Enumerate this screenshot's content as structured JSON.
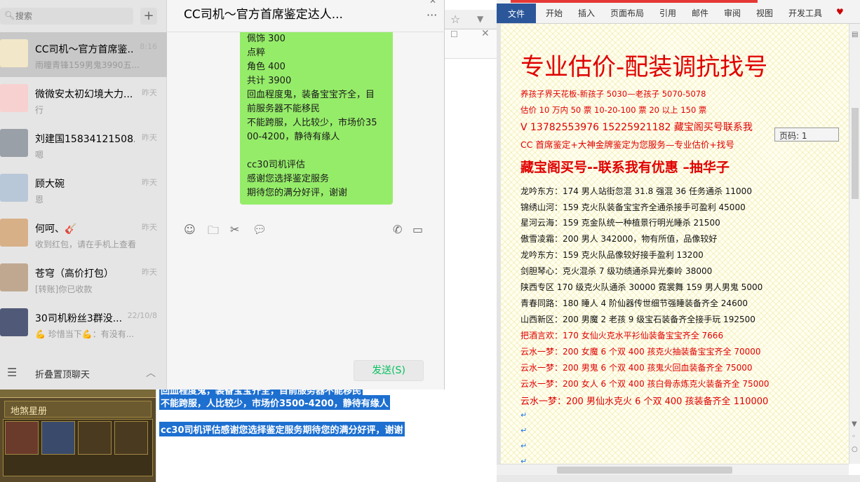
{
  "wechat": {
    "search_placeholder": "搜索",
    "add_label": "+",
    "conversations": [
      {
        "name": "CC司机～官方首席鉴...",
        "msg": "雨瞳青锋159男鬼3990五...",
        "time": "8:16"
      },
      {
        "name": "微微安太初幻境大力...",
        "msg": "行",
        "time": "昨天"
      },
      {
        "name": "刘建国1583412150​8...",
        "msg": "嗯",
        "time": "昨天"
      },
      {
        "name": "顾大碗",
        "msg": "恩",
        "time": "昨天"
      },
      {
        "name": "何呵、🎸",
        "msg": "收到红包，请在手机上查看",
        "time": "昨天"
      },
      {
        "name": "苍穹（高价打包）",
        "msg": "[转账]你已收款",
        "time": "昨天"
      },
      {
        "name": "30司机粉丝3群没...",
        "msg": "💪 珍惜当下💪：有没有...",
        "time": "22/10/8"
      }
    ],
    "fold_label": "折叠置顶聊天",
    "chat_title": "CC司机～官方首席鉴定达人...",
    "bubble_lines": [
      "佩饰                300",
      "点粹",
      "角色                    400",
      "共计 3900",
      "回血程度鬼，装备宝宝齐全，目",
      "前服务器不能移民",
      "不能跨服，人比较少，市场价35",
      "00-4200，静待有缘人",
      "",
      "cc30司机评估",
      "感谢您选择鉴定服务",
      "期待您的满分好评，谢谢"
    ],
    "send_label": "发送(S)"
  },
  "background": {
    "game_panel_title": "地煞星册",
    "selected_lines": [
      "回血程度鬼，装备宝宝齐全，目前服务器不能移民",
      "不能跨服，人比较少，市场价3500-4200，静待有缘人",
      "cc30司机评估感谢您选择鉴定服务期待您的满分好评，谢谢"
    ]
  },
  "word": {
    "tabs": [
      "文件",
      "开始",
      "插入",
      "页面布局",
      "引用",
      "邮件",
      "审阅",
      "视图",
      "开发工具"
    ],
    "page_tip": "页码: 1",
    "title": "专业估价-配装调抗找号",
    "lines": [
      "养孩子界天花板-新孩子 5030—老孩子 5070-5078",
      "估价 10 万内 50 票    10-20-100 票      20 以上 150 票",
      "V 13782553976    15225921182  藏宝阁买号联系我",
      "CC 首席鉴定+大神金牌鉴定为您服务—专业估价+找号",
      "藏宝阁买号--联系我有优惠 –抽华子",
      "龙吟东方：174 男人站街忽混 31.8 强混 36 任务通杀 11000",
      "锦绣山河：159 克火队装备宝宝齐全通杀接手可盈利 45000",
      "星河云海：159 克金队统一种植景行明光睡杀 21500",
      "傲雪凌霜：200 男人 342000，物有所值，品像较好",
      "龙吟东方：159 克火队品像较好接手盈利 13200",
      "剑胆琴心：克火混杀 7 级功绩通杀异光秦岭 38000",
      "陕西专区 170 级克火队通杀 30000      霓裳舞 159 男人男鬼 5000",
      "青春同路：180 睡人 4 阶仙器传世细节强睡装备齐全 24600",
      "山西新区：200 男魔 2 老孩 9 级宝石装备齐全接手玩 192500",
      "把酒言欢：170 女仙火克水平衫仙装备宝宝齐全 7666",
      "云水一梦：200 女魔 6 个双 400 孩克火抽装备宝宝齐全 70000",
      "云水一梦：200 男鬼 6 个双 400 孩鬼火回血装备齐全 75000",
      "云水一梦：200 女人 6 个双 400 孩白骨赤炼克火装备齐全 75000",
      "云水一梦：200 男仙水克火 6 个双 400 孩装备齐全 110000"
    ]
  },
  "colors": {
    "wechat_bubble": "#95ec69",
    "wechat_send": "#07c160",
    "word_file_tab": "#2b579a",
    "doc_red": "#e00000",
    "selection": "#1d6fd0"
  },
  "icons": [
    "search-icon",
    "add-icon",
    "emoji-icon",
    "folder-icon",
    "scissors-icon",
    "chat-icon",
    "phone-icon",
    "video-icon",
    "menu-icon",
    "chevron-up-icon",
    "more-icon",
    "close-icon"
  ]
}
